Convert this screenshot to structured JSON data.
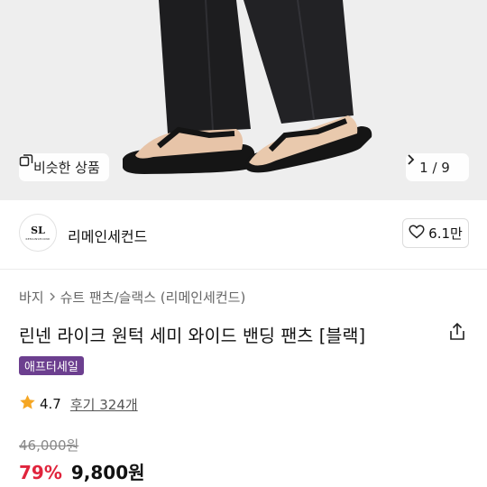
{
  "hero": {
    "similar_label": "비슷한 상품",
    "counter": "1 / 9",
    "counter_icon": "chevron-right-icon",
    "similar_icon": "copy-icon"
  },
  "shop": {
    "logo_mark": "SL",
    "logo_text": "REMAINSECOND",
    "name": "리메인세컨드",
    "likes": "6.1만",
    "like_icon": "heart-icon"
  },
  "breadcrumb": {
    "items": [
      "바지",
      "슈트 팬츠/슬랙스 (리메인세컨드)"
    ],
    "separator_icon": "chevron-right-icon"
  },
  "product": {
    "title": "린넨 라이크 원턱 세미 와이드 밴딩 팬츠 [블랙]",
    "badge": "애프터세일",
    "badge_color": "#6c3f8f",
    "rating": "4.7",
    "reviews": "후기 324개",
    "original_price": "46,000원",
    "discount": "79%",
    "price": "9,800원",
    "discount_color": "#e0243c",
    "star_color": "#f5a623"
  }
}
